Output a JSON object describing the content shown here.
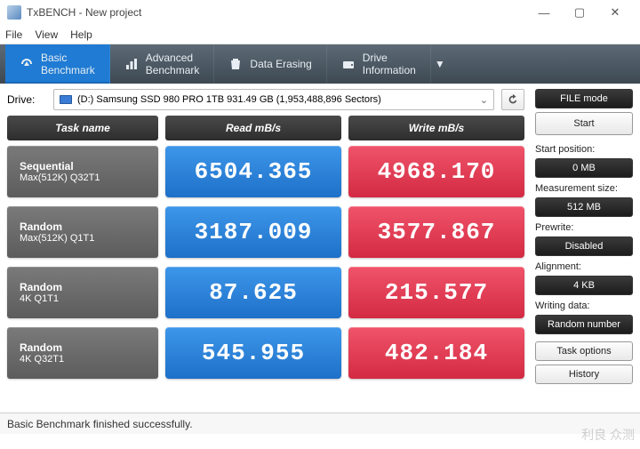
{
  "window": {
    "title": "TxBENCH - New project"
  },
  "menu": {
    "file": "File",
    "view": "View",
    "help": "Help"
  },
  "tabs": [
    {
      "label": "Basic\nBenchmark",
      "active": true
    },
    {
      "label": "Advanced\nBenchmark",
      "active": false
    },
    {
      "label": "Data Erasing",
      "active": false
    },
    {
      "label": "Drive\nInformation",
      "active": false
    }
  ],
  "drive": {
    "label": "Drive:",
    "value": "(D:) Samsung SSD 980 PRO 1TB  931.49 GB (1,953,488,896 Sectors)"
  },
  "headers": {
    "task": "Task name",
    "read": "Read mB/s",
    "write": "Write mB/s"
  },
  "rows": [
    {
      "name1": "Sequential",
      "name2": "Max(512K) Q32T1",
      "read": "6504.365",
      "write": "4968.170"
    },
    {
      "name1": "Random",
      "name2": "Max(512K) Q1T1",
      "read": "3187.009",
      "write": "3577.867"
    },
    {
      "name1": "Random",
      "name2": "4K Q1T1",
      "read": "87.625",
      "write": "215.577"
    },
    {
      "name1": "Random",
      "name2": "4K Q32T1",
      "read": "545.955",
      "write": "482.184"
    }
  ],
  "side": {
    "file_mode": "FILE mode",
    "start": "Start",
    "start_pos_label": "Start position:",
    "start_pos_value": "0 MB",
    "meas_size_label": "Measurement size:",
    "meas_size_value": "512 MB",
    "prewrite_label": "Prewrite:",
    "prewrite_value": "Disabled",
    "alignment_label": "Alignment:",
    "alignment_value": "4 KB",
    "writing_data_label": "Writing data:",
    "writing_data_value": "Random number",
    "task_options": "Task options",
    "history": "History"
  },
  "status": "Basic Benchmark finished successfully.",
  "watermark": "利良 众测"
}
